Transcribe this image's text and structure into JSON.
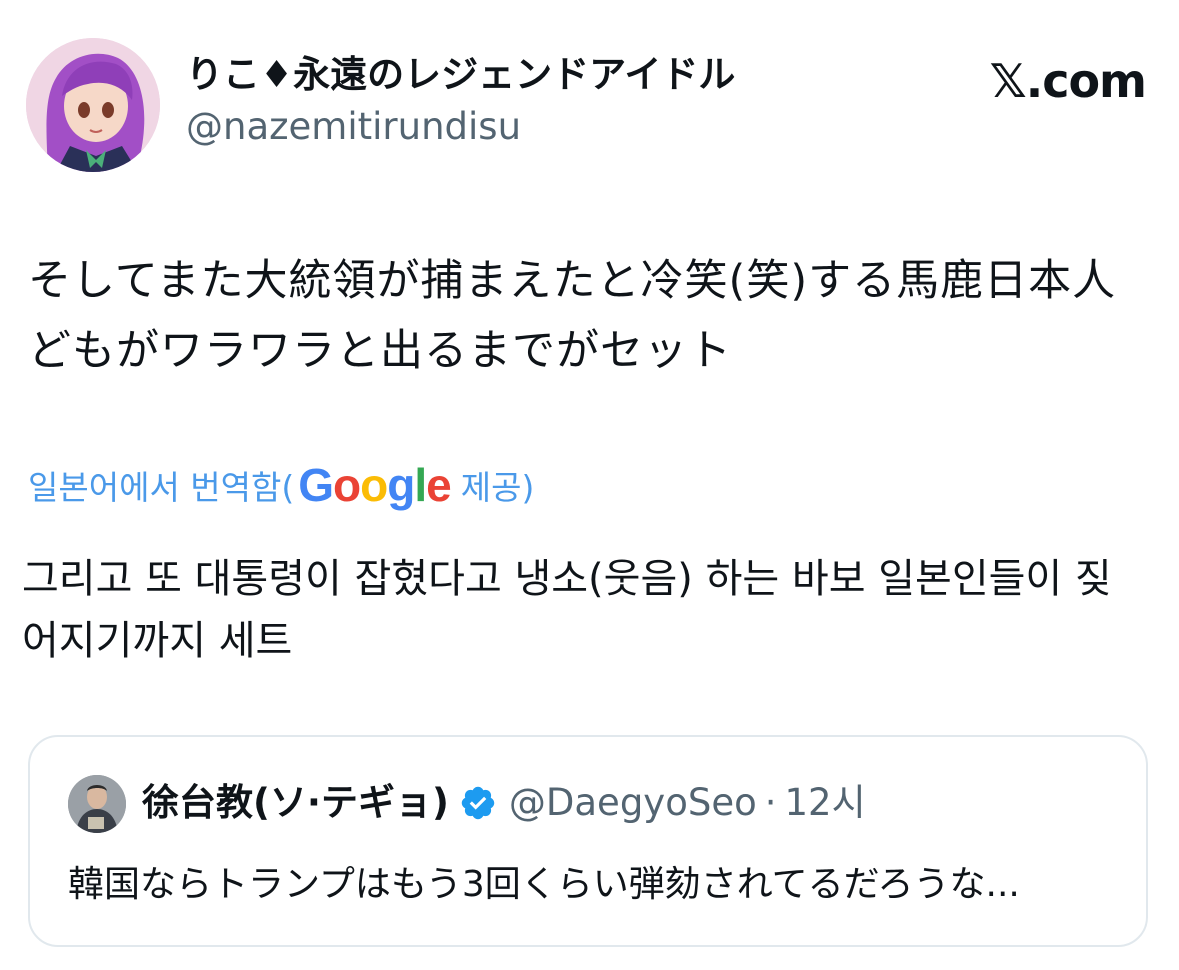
{
  "author": {
    "display_name": "りこ♦永遠のレジェンドアイドル",
    "handle": "@nazemitirundisu"
  },
  "brand": "𝕏.com",
  "tweet": {
    "line1": "そしてまた大統領が捕まえたと冷笑(笑)する馬鹿日本人",
    "line2": "どもがワラワラと出るまでがセット"
  },
  "translation": {
    "prefix": "일본어에서 번역함(",
    "google": {
      "G": "G",
      "o1": "o",
      "o2": "o",
      "g": "g",
      "l": "l",
      "e": "e"
    },
    "suffix": "제공)",
    "line1": "그리고 또 대통령이 잡혔다고 냉소(웃음) 하는 바보 일본인들이 짖",
    "line2": "어지기까지 세트"
  },
  "quoted": {
    "display_name": "徐台教(ソ·テギョ)",
    "handle": "@DaegyoSeo",
    "separator": "·",
    "time": "12시",
    "text": "韓国ならトランプはもう3回くらい弾劾されてるだろうな..."
  },
  "colors": {
    "link_blue": "#4a99e9",
    "verified_blue": "#1d9bf0",
    "secondary_text": "#536471",
    "border": "#e1e8ed"
  },
  "icons": {
    "verified": "verified-badge-icon"
  }
}
